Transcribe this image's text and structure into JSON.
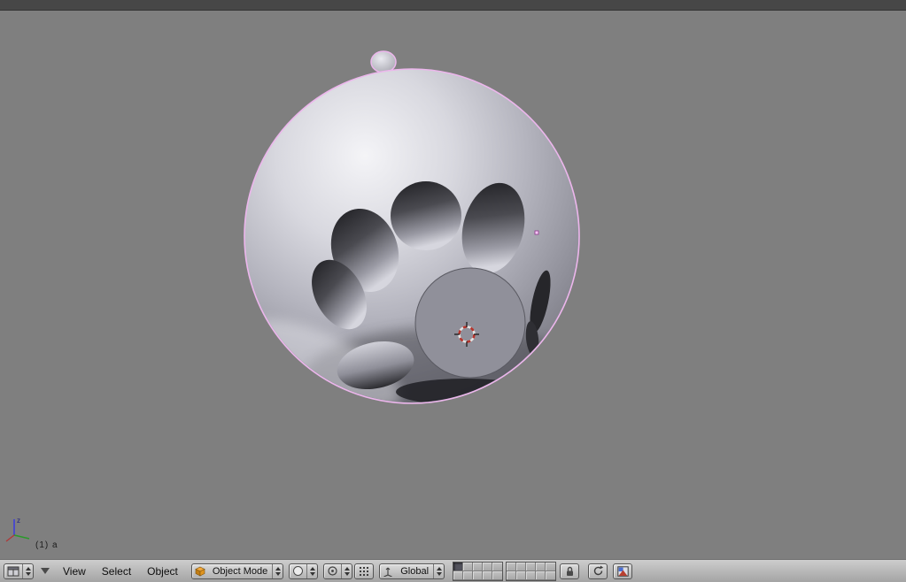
{
  "viewport": {
    "info_text": "(1) a",
    "axis": {
      "z_label": "z"
    }
  },
  "header": {
    "editor_type_select": {
      "icon": "viewport-grid-icon"
    },
    "collapse": {
      "icon": "collapse-triangle-icon"
    },
    "menus": [
      {
        "label": "View"
      },
      {
        "label": "Select"
      },
      {
        "label": "Object"
      }
    ],
    "mode_select": {
      "value": "Object Mode",
      "icon": "cube-icon"
    },
    "draw_type_select": {
      "icon": "shading-circle-icon"
    },
    "pivot_select": {
      "icon": "pivot-point-icon"
    },
    "manipulator_button": {
      "icon": "grid-dots-icon"
    },
    "orientation_select": {
      "value": "Global",
      "icon": "axis-icon"
    },
    "layers": {
      "groups": 2,
      "per_group": 10,
      "active_indices": [
        0
      ]
    },
    "lock_button": {
      "icon": "lock-icon"
    },
    "extra_buttons": [
      {
        "icon": "history-arrows-icon"
      },
      {
        "icon": "render-image-icon"
      }
    ]
  },
  "colors": {
    "viewport_bg": "#7f7f7f",
    "top_strip": "#474747",
    "header_bg": "#bdbdbd",
    "selection_outline": "#ecb6ec",
    "cursor_red": "#b5342c",
    "object_base": "#c9c9d2"
  }
}
